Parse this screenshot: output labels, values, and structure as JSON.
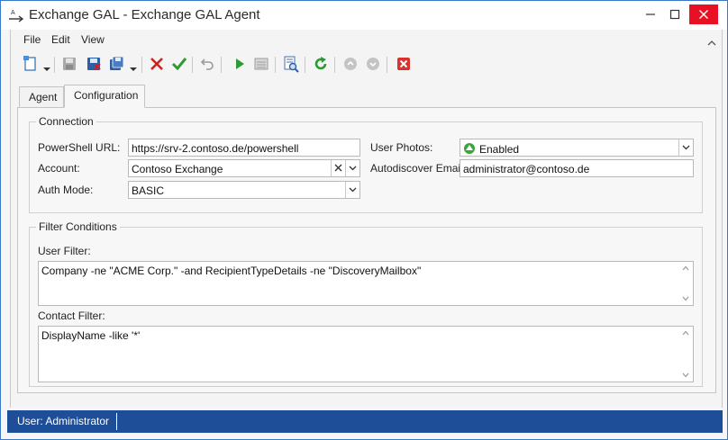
{
  "window": {
    "title": "Exchange GAL - Exchange GAL Agent"
  },
  "menu": {
    "items": [
      "File",
      "Edit",
      "View"
    ]
  },
  "toolbar": {
    "icons": [
      "new-document-icon",
      "save-icon",
      "save-close-icon",
      "save-as-icon",
      "delete-icon",
      "accept-icon",
      "undo-icon",
      "run-icon",
      "stop-icon",
      "preview-icon",
      "refresh-icon",
      "move-up-icon",
      "move-down-icon",
      "close-red-icon"
    ]
  },
  "tabs": [
    {
      "label": "Agent",
      "active": false
    },
    {
      "label": "Configuration",
      "active": true
    }
  ],
  "connection": {
    "group_title": "Connection",
    "powershell_url": {
      "label": "PowerShell URL:",
      "value": "https://srv-2.contoso.de/powershell"
    },
    "account": {
      "label": "Account:",
      "value": "Contoso Exchange"
    },
    "auth_mode": {
      "label": "Auth Mode:",
      "value": "BASIC"
    },
    "user_photos": {
      "label": "User Photos:",
      "value": "Enabled",
      "status_color": "#3aa53a"
    },
    "autodiscover_email": {
      "label": "Autodiscover Email:",
      "value": "administrator@contoso.de"
    }
  },
  "filters": {
    "group_title": "Filter Conditions",
    "user_filter": {
      "label": "User Filter:",
      "value": "Company -ne \"ACME Corp.\" -and RecipientTypeDetails -ne \"DiscoveryMailbox\""
    },
    "contact_filter": {
      "label": "Contact Filter:",
      "value": "DisplayName -like '*'"
    }
  },
  "statusbar": {
    "text": "User: Administrator",
    "color": "#1f4e99"
  }
}
